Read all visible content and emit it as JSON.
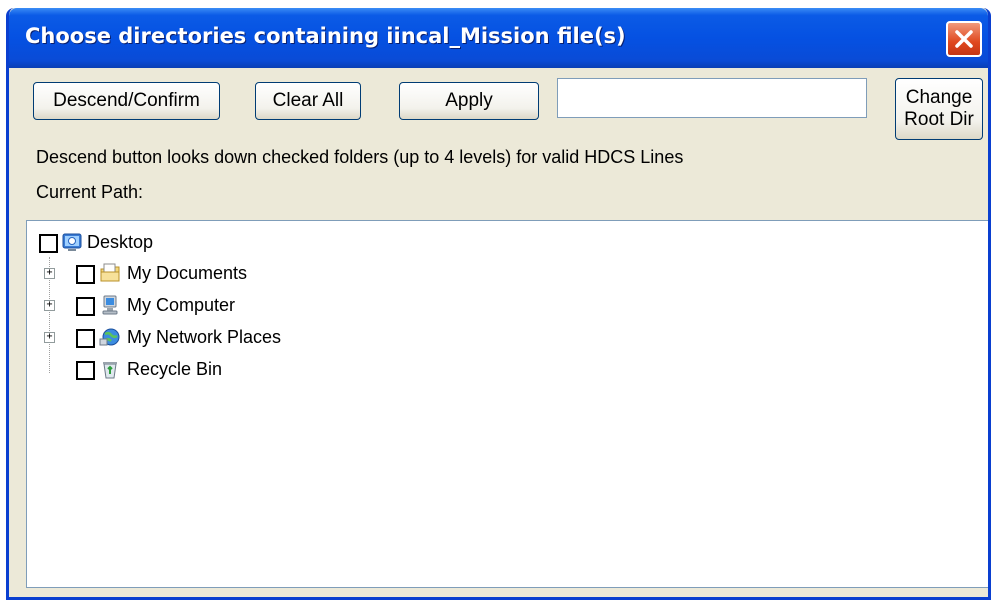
{
  "window": {
    "title": "Choose directories containing iincal_Mission file(s)"
  },
  "toolbar": {
    "descend_label": "Descend/Confirm",
    "clear_label": "Clear All",
    "apply_label": "Apply",
    "path_value": "",
    "change_root_line1": "Change",
    "change_root_line2": "Root Dir"
  },
  "info": {
    "descend_hint": "Descend button looks down checked folders (up to 4 levels) for valid HDCS Lines",
    "current_path_label": "Current Path:"
  },
  "tree": {
    "root": {
      "label": "Desktop",
      "icon": "desktop-icon",
      "checked": false
    },
    "children": [
      {
        "label": "My Documents",
        "icon": "my-documents-icon",
        "expandable": true,
        "checked": false
      },
      {
        "label": "My Computer",
        "icon": "my-computer-icon",
        "expandable": true,
        "checked": false
      },
      {
        "label": "My Network Places",
        "icon": "network-places-icon",
        "expandable": true,
        "checked": false
      },
      {
        "label": "Recycle Bin",
        "icon": "recycle-bin-icon",
        "expandable": false,
        "checked": false
      }
    ]
  },
  "colors": {
    "titlebar": "#0551e2",
    "close": "#e0481e",
    "dialog_bg": "#ece9d8",
    "button_border": "#003c74"
  }
}
